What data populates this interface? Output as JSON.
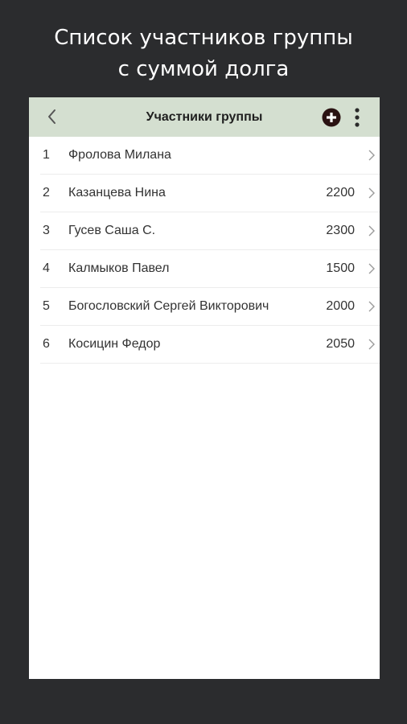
{
  "caption": {
    "line1": "Список участников группы",
    "line2": "с суммой долга"
  },
  "appbar": {
    "title": "Участники группы",
    "back_icon": "chevron-left-icon",
    "add_icon": "add-circle-icon",
    "more_icon": "more-vertical-icon",
    "background": "#d4dfd0"
  },
  "members": [
    {
      "index": "1",
      "name": "Фролова Милана",
      "amount": ""
    },
    {
      "index": "2",
      "name": "Казанцева Нина",
      "amount": "2200"
    },
    {
      "index": "3",
      "name": "Гусев Саша С.",
      "amount": "2300"
    },
    {
      "index": "4",
      "name": "Калмыков Павел",
      "amount": "1500"
    },
    {
      "index": "5",
      "name": "Богословский Сергей Викторович",
      "amount": "2000"
    },
    {
      "index": "6",
      "name": "Косицин Федор",
      "amount": "2050"
    }
  ]
}
